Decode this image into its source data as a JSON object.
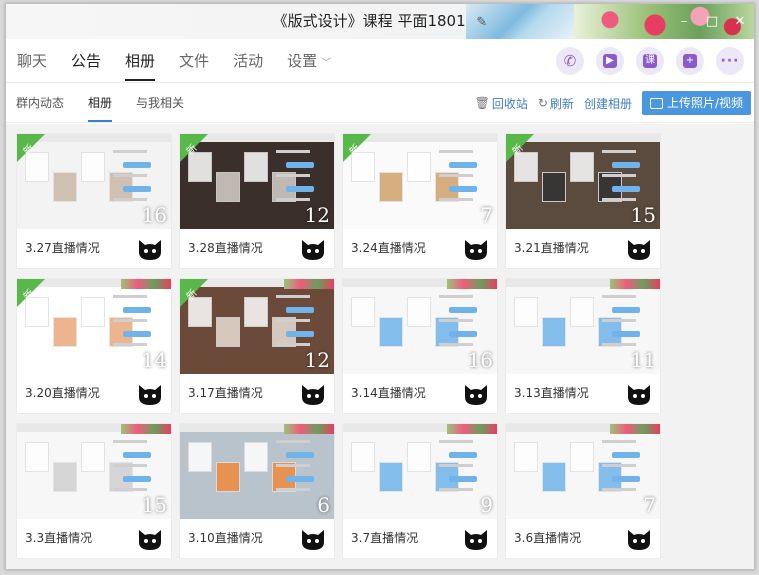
{
  "window": {
    "title": "《版式设计》课程 平面1801",
    "edit_icon": "edit-pencil-icon"
  },
  "tabs": [
    {
      "label": "聊天"
    },
    {
      "label": "公告"
    },
    {
      "label": "相册"
    },
    {
      "label": "文件"
    },
    {
      "label": "活动"
    },
    {
      "label": "设置"
    }
  ],
  "actions": [
    {
      "icon": "phone-icon"
    },
    {
      "icon": "video-icon"
    },
    {
      "icon": "lesson-icon",
      "glyph": "课"
    },
    {
      "icon": "add-app-icon",
      "glyph": "+"
    },
    {
      "icon": "more-icon"
    }
  ],
  "subtabs": [
    {
      "label": "群内动态"
    },
    {
      "label": "相册"
    },
    {
      "label": "与我相关"
    }
  ],
  "sub_actions": {
    "recycle": "回收站",
    "refresh": "刷新",
    "create": "创建相册",
    "upload": "上传照片/视频"
  },
  "badge_text": "新",
  "albums": [
    {
      "caption": "3.27直播情况",
      "count": "16",
      "new": true
    },
    {
      "caption": "3.28直播情况",
      "count": "12",
      "new": true
    },
    {
      "caption": "3.24直播情况",
      "count": "7",
      "new": true
    },
    {
      "caption": "3.21直播情况",
      "count": "15",
      "new": true
    },
    {
      "caption": "3.20直播情况",
      "count": "14",
      "new": true
    },
    {
      "caption": "3.17直播情况",
      "count": "12",
      "new": true
    },
    {
      "caption": "3.14直播情况",
      "count": "16",
      "new": false
    },
    {
      "caption": "3.13直播情况",
      "count": "11",
      "new": false
    },
    {
      "caption": "3.3直播情况",
      "count": "15",
      "new": false
    },
    {
      "caption": "3.10直播情况",
      "count": "6",
      "new": false
    },
    {
      "caption": "3.7直播情况",
      "count": "9",
      "new": false
    },
    {
      "caption": "3.6直播情况",
      "count": "7",
      "new": false
    }
  ]
}
